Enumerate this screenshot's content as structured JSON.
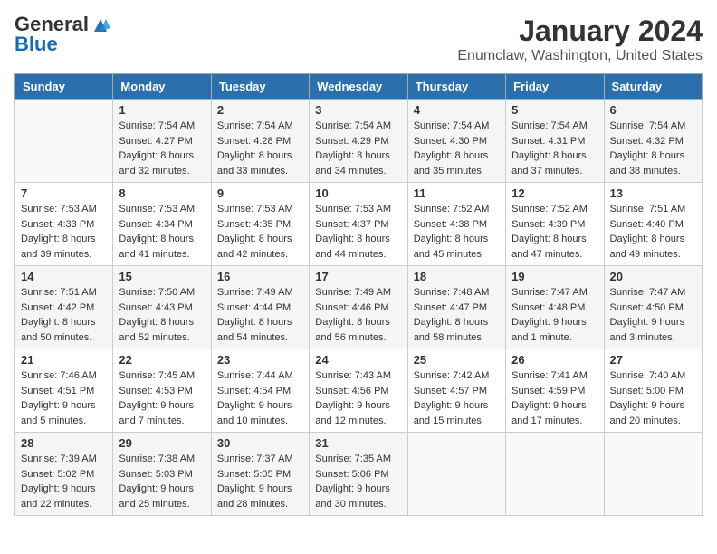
{
  "header": {
    "logo_general": "General",
    "logo_blue": "Blue",
    "title": "January 2024",
    "subtitle": "Enumclaw, Washington, United States"
  },
  "days_of_week": [
    "Sunday",
    "Monday",
    "Tuesday",
    "Wednesday",
    "Thursday",
    "Friday",
    "Saturday"
  ],
  "weeks": [
    [
      {
        "day": "",
        "info": ""
      },
      {
        "day": "1",
        "info": "Sunrise: 7:54 AM\nSunset: 4:27 PM\nDaylight: 8 hours\nand 32 minutes."
      },
      {
        "day": "2",
        "info": "Sunrise: 7:54 AM\nSunset: 4:28 PM\nDaylight: 8 hours\nand 33 minutes."
      },
      {
        "day": "3",
        "info": "Sunrise: 7:54 AM\nSunset: 4:29 PM\nDaylight: 8 hours\nand 34 minutes."
      },
      {
        "day": "4",
        "info": "Sunrise: 7:54 AM\nSunset: 4:30 PM\nDaylight: 8 hours\nand 35 minutes."
      },
      {
        "day": "5",
        "info": "Sunrise: 7:54 AM\nSunset: 4:31 PM\nDaylight: 8 hours\nand 37 minutes."
      },
      {
        "day": "6",
        "info": "Sunrise: 7:54 AM\nSunset: 4:32 PM\nDaylight: 8 hours\nand 38 minutes."
      }
    ],
    [
      {
        "day": "7",
        "info": "Sunrise: 7:53 AM\nSunset: 4:33 PM\nDaylight: 8 hours\nand 39 minutes."
      },
      {
        "day": "8",
        "info": "Sunrise: 7:53 AM\nSunset: 4:34 PM\nDaylight: 8 hours\nand 41 minutes."
      },
      {
        "day": "9",
        "info": "Sunrise: 7:53 AM\nSunset: 4:35 PM\nDaylight: 8 hours\nand 42 minutes."
      },
      {
        "day": "10",
        "info": "Sunrise: 7:53 AM\nSunset: 4:37 PM\nDaylight: 8 hours\nand 44 minutes."
      },
      {
        "day": "11",
        "info": "Sunrise: 7:52 AM\nSunset: 4:38 PM\nDaylight: 8 hours\nand 45 minutes."
      },
      {
        "day": "12",
        "info": "Sunrise: 7:52 AM\nSunset: 4:39 PM\nDaylight: 8 hours\nand 47 minutes."
      },
      {
        "day": "13",
        "info": "Sunrise: 7:51 AM\nSunset: 4:40 PM\nDaylight: 8 hours\nand 49 minutes."
      }
    ],
    [
      {
        "day": "14",
        "info": "Sunrise: 7:51 AM\nSunset: 4:42 PM\nDaylight: 8 hours\nand 50 minutes."
      },
      {
        "day": "15",
        "info": "Sunrise: 7:50 AM\nSunset: 4:43 PM\nDaylight: 8 hours\nand 52 minutes."
      },
      {
        "day": "16",
        "info": "Sunrise: 7:49 AM\nSunset: 4:44 PM\nDaylight: 8 hours\nand 54 minutes."
      },
      {
        "day": "17",
        "info": "Sunrise: 7:49 AM\nSunset: 4:46 PM\nDaylight: 8 hours\nand 56 minutes."
      },
      {
        "day": "18",
        "info": "Sunrise: 7:48 AM\nSunset: 4:47 PM\nDaylight: 8 hours\nand 58 minutes."
      },
      {
        "day": "19",
        "info": "Sunrise: 7:47 AM\nSunset: 4:48 PM\nDaylight: 9 hours\nand 1 minute."
      },
      {
        "day": "20",
        "info": "Sunrise: 7:47 AM\nSunset: 4:50 PM\nDaylight: 9 hours\nand 3 minutes."
      }
    ],
    [
      {
        "day": "21",
        "info": "Sunrise: 7:46 AM\nSunset: 4:51 PM\nDaylight: 9 hours\nand 5 minutes."
      },
      {
        "day": "22",
        "info": "Sunrise: 7:45 AM\nSunset: 4:53 PM\nDaylight: 9 hours\nand 7 minutes."
      },
      {
        "day": "23",
        "info": "Sunrise: 7:44 AM\nSunset: 4:54 PM\nDaylight: 9 hours\nand 10 minutes."
      },
      {
        "day": "24",
        "info": "Sunrise: 7:43 AM\nSunset: 4:56 PM\nDaylight: 9 hours\nand 12 minutes."
      },
      {
        "day": "25",
        "info": "Sunrise: 7:42 AM\nSunset: 4:57 PM\nDaylight: 9 hours\nand 15 minutes."
      },
      {
        "day": "26",
        "info": "Sunrise: 7:41 AM\nSunset: 4:59 PM\nDaylight: 9 hours\nand 17 minutes."
      },
      {
        "day": "27",
        "info": "Sunrise: 7:40 AM\nSunset: 5:00 PM\nDaylight: 9 hours\nand 20 minutes."
      }
    ],
    [
      {
        "day": "28",
        "info": "Sunrise: 7:39 AM\nSunset: 5:02 PM\nDaylight: 9 hours\nand 22 minutes."
      },
      {
        "day": "29",
        "info": "Sunrise: 7:38 AM\nSunset: 5:03 PM\nDaylight: 9 hours\nand 25 minutes."
      },
      {
        "day": "30",
        "info": "Sunrise: 7:37 AM\nSunset: 5:05 PM\nDaylight: 9 hours\nand 28 minutes."
      },
      {
        "day": "31",
        "info": "Sunrise: 7:35 AM\nSunset: 5:06 PM\nDaylight: 9 hours\nand 30 minutes."
      },
      {
        "day": "",
        "info": ""
      },
      {
        "day": "",
        "info": ""
      },
      {
        "day": "",
        "info": ""
      }
    ]
  ]
}
